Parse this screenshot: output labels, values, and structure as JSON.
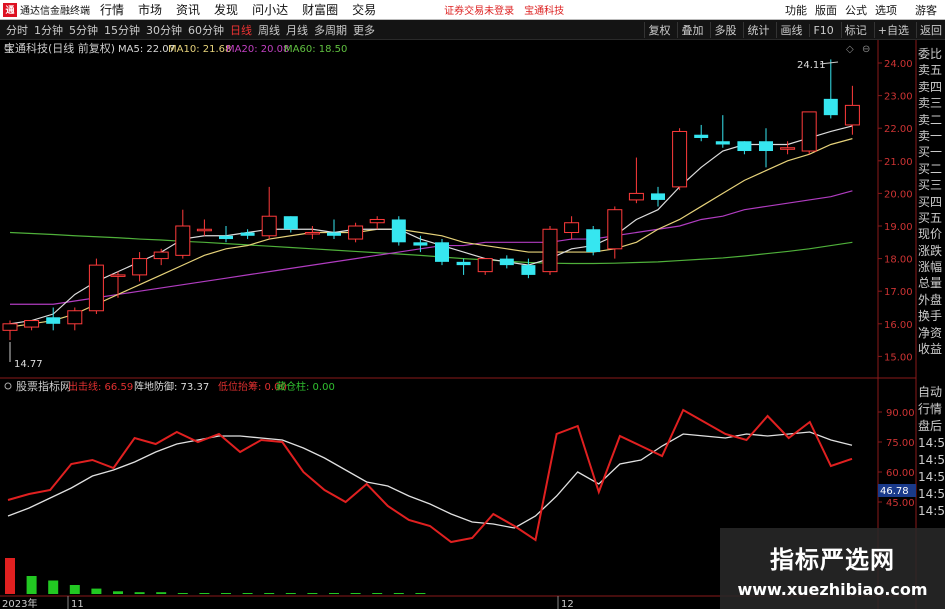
{
  "menubar": {
    "logo_char": "通",
    "app_title": "通达信金融终端",
    "items": [
      "行情",
      "市场",
      "资讯",
      "发现",
      "问小达",
      "财富圈",
      "交易"
    ],
    "notice": "证券交易未登录",
    "stock_name_notice": "宝通科技",
    "right_items": [
      "功能",
      "版面",
      "公式",
      "选项",
      "游客"
    ]
  },
  "toolbar": {
    "periods": [
      "分时",
      "1分钟",
      "5分钟",
      "15分钟",
      "30分钟",
      "60分钟",
      "日线",
      "周线",
      "月线",
      "多周期",
      "更多"
    ],
    "active_period": "日线",
    "right_buttons": [
      "复权",
      "叠加",
      "多股",
      "统计",
      "画线",
      "F10",
      "标记",
      "+自选",
      "返回"
    ]
  },
  "price_panel": {
    "stock_title": "宝通科技(日线 前复权)",
    "ma_legend": [
      {
        "label": "MA5: 22.07",
        "color": "#d8d8d8"
      },
      {
        "label": "MA10: 21.68",
        "color": "#e6d27a"
      },
      {
        "label": "MA20: 20.08",
        "color": "#c040c0"
      },
      {
        "label": "MA60: 18.50",
        "color": "#60c040"
      }
    ],
    "high_label": "24.11",
    "low_label": "14.77",
    "axis_ticks": [
      "24.00",
      "23.00",
      "22.00",
      "21.00",
      "20.00",
      "19.00",
      "18.00",
      "17.00",
      "16.00",
      "15.00"
    ]
  },
  "indicator_panel": {
    "title": "股票指标网",
    "legend": [
      {
        "label": "出击线: 66.59",
        "color": "#e03030"
      },
      {
        "label": "阵地防御: 73.37",
        "color": "#dddddd"
      },
      {
        "label": "低位抬筹: 0.00",
        "color": "#e03030"
      },
      {
        "label": "藏仓柱: 0.00",
        "color": "#30c030"
      }
    ],
    "axis_ticks": [
      "90.00",
      "75.00",
      "60.00",
      "45.00"
    ],
    "current_value": "46.78"
  },
  "date_axis": {
    "year": "2023年",
    "labels": [
      "11",
      "12"
    ]
  },
  "side_panel_top": [
    "委比",
    "卖五",
    "卖四",
    "卖三",
    "卖二",
    "卖一",
    "买一",
    "买二",
    "买三",
    "买四",
    "买五",
    "现价",
    "涨跌",
    "涨幅",
    "总量",
    "外盘",
    "换手",
    "净资",
    "收益"
  ],
  "side_panel_bottom": [
    "自动",
    "行情",
    "盘后",
    "14:50",
    "14:50",
    "14:50",
    "14:50",
    "14:5"
  ],
  "watermark": {
    "title": "指标严选网",
    "url": "www.xuezhibiao.com"
  },
  "chart_data": {
    "type": "candlestick",
    "candles": [
      {
        "o": 15.8,
        "h": 16.1,
        "l": 15.5,
        "c": 16.0
      },
      {
        "o": 15.9,
        "h": 16.1,
        "l": 15.8,
        "c": 16.1
      },
      {
        "o": 16.2,
        "h": 16.5,
        "l": 15.8,
        "c": 16.0
      },
      {
        "o": 16.0,
        "h": 16.5,
        "l": 15.8,
        "c": 16.4
      },
      {
        "o": 16.4,
        "h": 18.0,
        "l": 16.3,
        "c": 17.8
      },
      {
        "o": 17.5,
        "h": 17.6,
        "l": 16.8,
        "c": 17.5
      },
      {
        "o": 17.5,
        "h": 18.2,
        "l": 17.3,
        "c": 18.0
      },
      {
        "o": 18.0,
        "h": 18.3,
        "l": 17.8,
        "c": 18.2
      },
      {
        "o": 18.1,
        "h": 19.5,
        "l": 18.0,
        "c": 19.0
      },
      {
        "o": 18.9,
        "h": 19.2,
        "l": 18.7,
        "c": 18.9
      },
      {
        "o": 18.7,
        "h": 19.0,
        "l": 18.5,
        "c": 18.6
      },
      {
        "o": 18.8,
        "h": 18.9,
        "l": 18.6,
        "c": 18.7
      },
      {
        "o": 18.7,
        "h": 20.2,
        "l": 18.6,
        "c": 19.3
      },
      {
        "o": 19.3,
        "h": 19.3,
        "l": 18.8,
        "c": 18.9
      },
      {
        "o": 18.8,
        "h": 19.0,
        "l": 18.6,
        "c": 18.8
      },
      {
        "o": 18.8,
        "h": 19.2,
        "l": 18.6,
        "c": 18.7
      },
      {
        "o": 18.6,
        "h": 19.1,
        "l": 18.5,
        "c": 19.0
      },
      {
        "o": 19.1,
        "h": 19.3,
        "l": 18.9,
        "c": 19.2
      },
      {
        "o": 19.2,
        "h": 19.3,
        "l": 18.4,
        "c": 18.5
      },
      {
        "o": 18.5,
        "h": 18.7,
        "l": 18.2,
        "c": 18.4
      },
      {
        "o": 18.5,
        "h": 18.6,
        "l": 17.8,
        "c": 17.9
      },
      {
        "o": 17.9,
        "h": 18.0,
        "l": 17.5,
        "c": 17.8
      },
      {
        "o": 17.6,
        "h": 18.0,
        "l": 17.5,
        "c": 18.0
      },
      {
        "o": 18.0,
        "h": 18.1,
        "l": 17.7,
        "c": 17.8
      },
      {
        "o": 17.8,
        "h": 18.0,
        "l": 17.4,
        "c": 17.5
      },
      {
        "o": 17.6,
        "h": 19.0,
        "l": 17.5,
        "c": 18.9
      },
      {
        "o": 18.8,
        "h": 19.3,
        "l": 18.6,
        "c": 19.1
      },
      {
        "o": 18.9,
        "h": 19.0,
        "l": 18.1,
        "c": 18.2
      },
      {
        "o": 18.3,
        "h": 19.6,
        "l": 18.0,
        "c": 19.5
      },
      {
        "o": 19.8,
        "h": 21.1,
        "l": 19.7,
        "c": 20.0
      },
      {
        "o": 20.0,
        "h": 20.2,
        "l": 19.6,
        "c": 19.8
      },
      {
        "o": 20.2,
        "h": 22.0,
        "l": 20.1,
        "c": 21.9
      },
      {
        "o": 21.8,
        "h": 22.1,
        "l": 21.6,
        "c": 21.7
      },
      {
        "o": 21.6,
        "h": 22.4,
        "l": 21.4,
        "c": 21.5
      },
      {
        "o": 21.6,
        "h": 21.6,
        "l": 21.2,
        "c": 21.3
      },
      {
        "o": 21.6,
        "h": 22.0,
        "l": 20.8,
        "c": 21.3
      },
      {
        "o": 21.4,
        "h": 21.6,
        "l": 21.2,
        "c": 21.4
      },
      {
        "o": 21.3,
        "h": 22.5,
        "l": 21.2,
        "c": 22.5
      },
      {
        "o": 22.9,
        "h": 24.11,
        "l": 22.3,
        "c": 22.4
      },
      {
        "o": 22.1,
        "h": 23.3,
        "l": 21.8,
        "c": 22.7
      }
    ],
    "ma5": [
      16.0,
      16.1,
      16.3,
      16.9,
      17.3,
      17.6,
      17.9,
      18.2,
      18.6,
      18.7,
      18.7,
      18.8,
      18.9,
      18.9,
      18.9,
      18.8,
      18.9,
      18.9,
      18.9,
      18.6,
      18.4,
      18.2,
      18.0,
      17.9,
      17.8,
      18.0,
      18.3,
      18.4,
      18.7,
      19.2,
      19.5,
      20.2,
      20.8,
      21.3,
      21.5,
      21.5,
      21.5,
      21.7,
      21.9,
      22.07
    ],
    "ma10": [
      15.9,
      16.0,
      16.1,
      16.3,
      16.6,
      16.9,
      17.2,
      17.5,
      17.8,
      18.1,
      18.3,
      18.4,
      18.6,
      18.7,
      18.8,
      18.8,
      18.8,
      18.9,
      18.9,
      18.8,
      18.7,
      18.5,
      18.4,
      18.3,
      18.2,
      18.2,
      18.2,
      18.2,
      18.3,
      18.5,
      18.9,
      19.2,
      19.6,
      20.0,
      20.4,
      20.7,
      21.0,
      21.2,
      21.5,
      21.68
    ],
    "ma20": [
      16.6,
      16.6,
      16.6,
      16.7,
      16.8,
      16.9,
      17.0,
      17.1,
      17.2,
      17.3,
      17.4,
      17.5,
      17.6,
      17.7,
      17.8,
      17.9,
      18.0,
      18.1,
      18.2,
      18.3,
      18.4,
      18.4,
      18.5,
      18.5,
      18.5,
      18.5,
      18.6,
      18.6,
      18.7,
      18.8,
      18.9,
      19.0,
      19.2,
      19.3,
      19.5,
      19.6,
      19.7,
      19.8,
      19.9,
      20.08
    ],
    "ma60": [
      18.8,
      18.77,
      18.74,
      18.7,
      18.67,
      18.64,
      18.6,
      18.57,
      18.53,
      18.5,
      18.46,
      18.42,
      18.38,
      18.34,
      18.3,
      18.26,
      18.22,
      18.18,
      18.14,
      18.1,
      18.05,
      18.0,
      17.96,
      17.92,
      17.88,
      17.86,
      17.85,
      17.85,
      17.86,
      17.88,
      17.9,
      17.94,
      17.98,
      18.02,
      18.08,
      18.15,
      18.22,
      18.3,
      18.4,
      18.5
    ],
    "attack_line": [
      46,
      49,
      51,
      64,
      66,
      62,
      77,
      74,
      80,
      75,
      79,
      70,
      76,
      75,
      60,
      51,
      45,
      54,
      43,
      36,
      33,
      25,
      27,
      39,
      33,
      26,
      79,
      83,
      50,
      78,
      73,
      68,
      91,
      85,
      79,
      76,
      88,
      77,
      85,
      63,
      66.59
    ],
    "defense_line": [
      38,
      42,
      47,
      52,
      58,
      61,
      65,
      70,
      74,
      76,
      78,
      78,
      77,
      76,
      72,
      67,
      61,
      55,
      53,
      48,
      44,
      39,
      35,
      34,
      32,
      38,
      48,
      60,
      54,
      64,
      66,
      73,
      79,
      78,
      77,
      79,
      78,
      79,
      80,
      76,
      73.37
    ],
    "green_bars": [
      2,
      1.5,
      1,
      0.6,
      0.3,
      0.2,
      0.2,
      0.1,
      0.1,
      0.1,
      0.1,
      0.1,
      0.05,
      0.05,
      0.05,
      0.05,
      0.05,
      0.05,
      0.05
    ],
    "red_bars": [
      4
    ]
  }
}
